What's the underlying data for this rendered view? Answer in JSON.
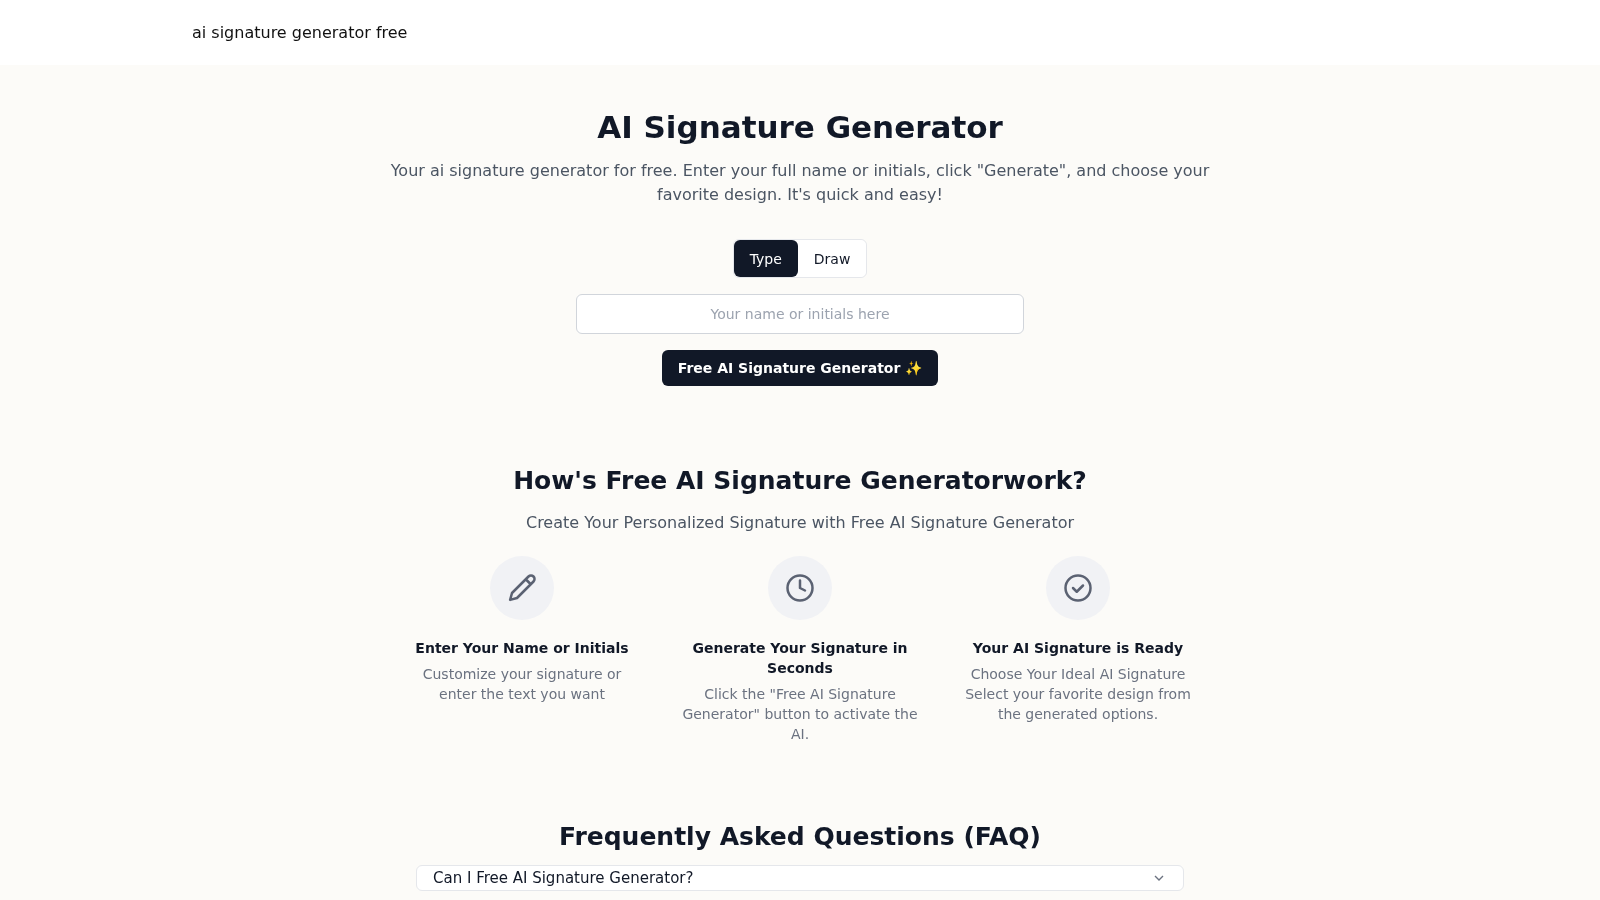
{
  "header": {
    "brand": "ai signature generator free"
  },
  "hero": {
    "title": "AI Signature Generator",
    "description": "Your ai signature generator for free. Enter your full name or initials, click \"Generate\", and choose your favorite design. It's quick and easy!",
    "modes": [
      {
        "label": "Type",
        "selected": true
      },
      {
        "label": "Draw",
        "selected": false
      }
    ],
    "input": {
      "placeholder": "Your name or initials here"
    },
    "button": "Free AI Signature Generator ✨"
  },
  "how": {
    "title": "How's Free AI Signature Generatorwork?",
    "subtitle": "Create Your Personalized Signature with Free AI Signature Generator",
    "steps": [
      {
        "kind": "pencil",
        "title": "Enter Your Name or Initials",
        "text": "Customize your signature or enter the text you want"
      },
      {
        "kind": "clock",
        "title": "Generate Your Signature in Seconds",
        "text": "Click the \"Free AI Signature Generator\" button to activate the AI."
      },
      {
        "kind": "check",
        "title": "Your AI Signature is Ready",
        "text": "Choose Your Ideal AI Signature Select your favorite design from the generated options."
      }
    ]
  },
  "faq": {
    "title": "Frequently Asked Questions (FAQ)",
    "items": [
      {
        "question": "Can I Free AI Signature Generator?",
        "expanded": false
      }
    ]
  }
}
